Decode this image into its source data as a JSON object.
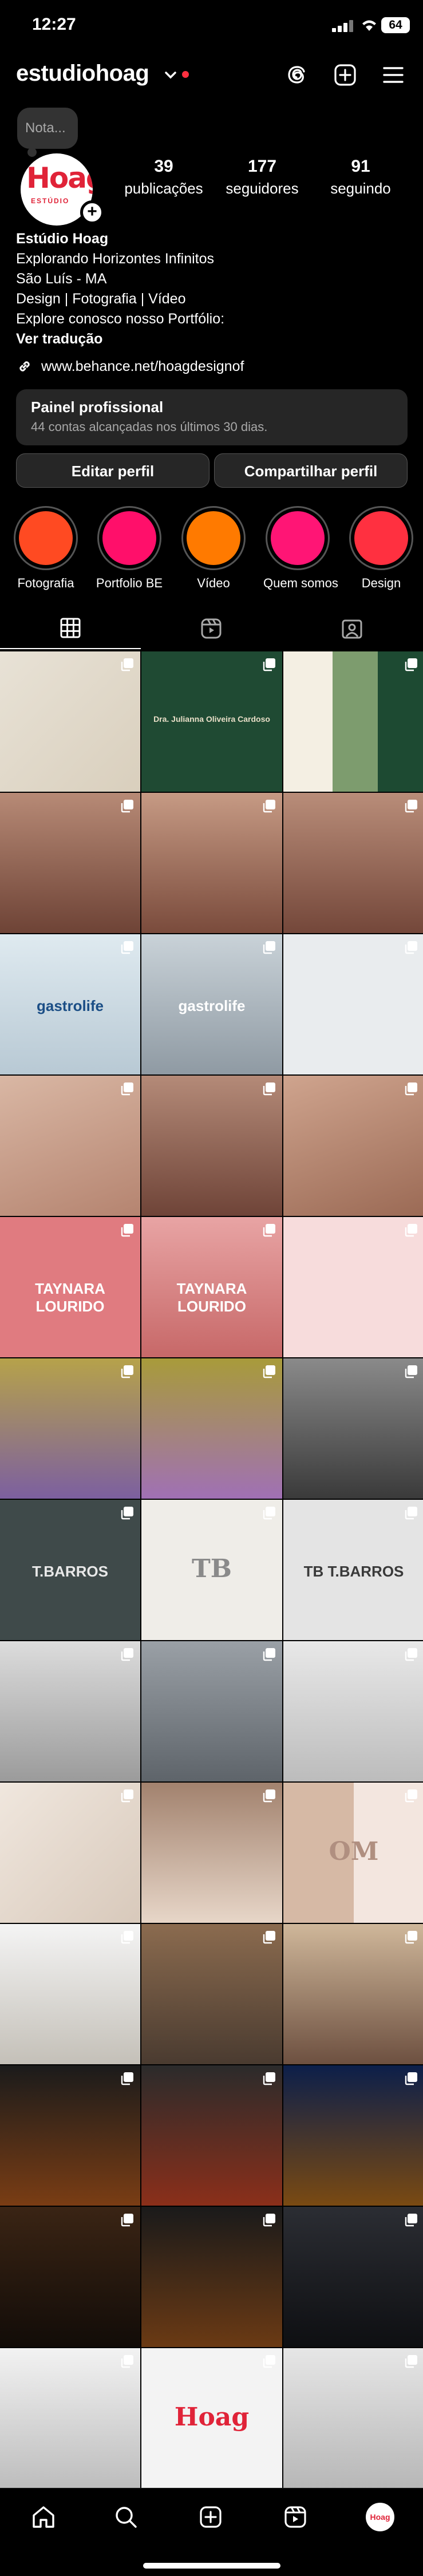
{
  "status": {
    "time": "12:27",
    "battery": "64"
  },
  "header": {
    "username": "estudiohoag"
  },
  "note": {
    "placeholder": "Nota..."
  },
  "avatar": {
    "logo_text": "Hoag",
    "logo_sub": "ESTÚDIO"
  },
  "stats": [
    {
      "value": "39",
      "label": "publicações"
    },
    {
      "value": "177",
      "label": "seguidores"
    },
    {
      "value": "91",
      "label": "seguindo"
    }
  ],
  "bio": {
    "name": "Estúdio Hoag",
    "lines": [
      "Explorando Horizontes Infinitos",
      "São Luís - MA",
      "Design | Fotografia | Vídeo",
      "Explore conosco nosso Portfólio:"
    ],
    "more": "Ver tradução",
    "link": "www.behance.net/hoagdesignof"
  },
  "panel": {
    "title": "Painel profissional",
    "subtitle": "44 contas alcançadas nos últimos 30 dias."
  },
  "buttons": {
    "edit": "Editar perfil",
    "share": "Compartilhar perfil"
  },
  "highlights": [
    {
      "label": "Fotografia",
      "color": "#ff4a22"
    },
    {
      "label": "Portfolio BE",
      "color": "#ff0f6a"
    },
    {
      "label": "Vídeo",
      "color": "#ff7a00"
    },
    {
      "label": "Quem somos",
      "color": "#ff1575"
    },
    {
      "label": "Design",
      "color": "#ff3040"
    }
  ],
  "tabs": [
    {
      "icon": "grid-icon"
    },
    {
      "icon": "reels-icon"
    },
    {
      "icon": "tagged-icon"
    }
  ],
  "posts": [
    {
      "bg": "linear-gradient(135deg,#e8e2d6,#d9cfbd)",
      "text": "",
      "color": "#1f4b34",
      "multi": true
    },
    {
      "bg": "#1f4a33",
      "text": "Dra. Julianna Oliveira Cardoso",
      "color": "#e9dfc8",
      "multi": true
    },
    {
      "bg": "linear-gradient(90deg,#f4efe3 35%,#7d9c6e 35%,#7d9c6e 67%,#1d4a32 67%)",
      "text": "",
      "color": "#1d4a32",
      "multi": true
    },
    {
      "bg": "linear-gradient(180deg,#b78a76,#6e4336)",
      "text": "",
      "color": "#fff",
      "multi": true
    },
    {
      "bg": "linear-gradient(180deg,#c69a84,#7a4b3c)",
      "text": "",
      "color": "#fff",
      "multi": true
    },
    {
      "bg": "linear-gradient(180deg,#b98d79,#74473a)",
      "text": "",
      "color": "#fff",
      "multi": true
    },
    {
      "bg": "linear-gradient(180deg,#dfeaf0,#b8c9d4)",
      "text": "gastrolife",
      "color": "#1b4e86",
      "multi": true
    },
    {
      "bg": "linear-gradient(180deg,#c9d2d8,#8f9aa3)",
      "text": "gastrolife",
      "color": "#ffffff",
      "multi": true
    },
    {
      "bg": "#e9ecee",
      "text": "",
      "color": "#1b4e86",
      "multi": true
    },
    {
      "bg": "linear-gradient(160deg,#d9b7a4,#b58470)",
      "text": "",
      "color": "#fff",
      "multi": true
    },
    {
      "bg": "linear-gradient(180deg,#b48a78,#6f4438)",
      "text": "",
      "color": "#fff",
      "multi": true
    },
    {
      "bg": "linear-gradient(160deg,#cfa48e,#9b6a55)",
      "text": "",
      "color": "#fff",
      "multi": true
    },
    {
      "bg": "#e07b80",
      "text": "TAYNARA LOURIDO",
      "color": "#fff",
      "multi": true
    },
    {
      "bg": "linear-gradient(180deg,#e8a4a4,#c76868)",
      "text": "TAYNARA LOURIDO",
      "color": "#fff",
      "multi": true
    },
    {
      "bg": "#f7dcdc",
      "text": "",
      "color": "#e27680",
      "multi": true
    },
    {
      "bg": "linear-gradient(180deg,#b6a24a,#7c5fa0)",
      "text": "",
      "color": "#fff",
      "multi": true
    },
    {
      "bg": "linear-gradient(180deg,#a89b3a,#a070b5)",
      "text": "",
      "color": "#fff",
      "multi": true
    },
    {
      "bg": "linear-gradient(180deg,#8a8a8a,#3a3a3a)",
      "text": "",
      "color": "#fff",
      "multi": true
    },
    {
      "bg": "#3f4a4a",
      "text": "T.BARROS",
      "color": "#e8e8e8",
      "multi": true
    },
    {
      "bg": "#efede8",
      "text": "TB",
      "color": "#8a8a8a",
      "multi": true
    },
    {
      "bg": "#e4e4e4",
      "text": "TB T.BARROS",
      "color": "#3a3a3a",
      "multi": true
    },
    {
      "bg": "linear-gradient(180deg,#dcdcdc,#9b9b9b)",
      "text": "",
      "color": "#fff",
      "multi": true
    },
    {
      "bg": "linear-gradient(180deg,#9aa0a6,#5e646a)",
      "text": "",
      "color": "#fff",
      "multi": true
    },
    {
      "bg": "linear-gradient(180deg,#e8e8e8,#bcbcbc)",
      "text": "",
      "color": "#fff",
      "multi": true
    },
    {
      "bg": "linear-gradient(135deg,#f0e7de,#d8c9bb)",
      "text": "",
      "color": "#2a4d2e",
      "multi": true
    },
    {
      "bg": "linear-gradient(180deg,#a2826e,#e7d6c8)",
      "text": "",
      "color": "#fff",
      "multi": true
    },
    {
      "bg": "linear-gradient(90deg,#d6b9a5 50%,#f3e6df 50%)",
      "text": "OM",
      "color": "#b08f80",
      "multi": true
    },
    {
      "bg": "linear-gradient(180deg,#f4f4f4,#c4c0b8)",
      "text": "",
      "color": "#fff",
      "multi": true
    },
    {
      "bg": "linear-gradient(180deg,#8b6b4f,#4a3b30)",
      "text": "",
      "color": "#fff",
      "multi": true
    },
    {
      "bg": "linear-gradient(180deg,#cfb79a,#6d5040)",
      "text": "",
      "color": "#fff",
      "multi": true
    },
    {
      "bg": "linear-gradient(180deg,#1b1b1b,#7a3d14)",
      "text": "",
      "color": "#fff",
      "multi": true
    },
    {
      "bg": "linear-gradient(180deg,#2b2b2b,#8b2f1a)",
      "text": "",
      "color": "#fff",
      "multi": true
    },
    {
      "bg": "linear-gradient(180deg,#0c1f4a,#7a4a12)",
      "text": "",
      "color": "#fff",
      "multi": true
    },
    {
      "bg": "linear-gradient(180deg,#3a2414,#120c08)",
      "text": "",
      "color": "#fff",
      "multi": true
    },
    {
      "bg": "linear-gradient(180deg,#1a1a1a,#6b3a14)",
      "text": "",
      "color": "#fff",
      "multi": true
    },
    {
      "bg": "linear-gradient(180deg,#2b2d33,#0e0f12)",
      "text": "",
      "color": "#fff",
      "multi": true
    },
    {
      "bg": "linear-gradient(180deg,#f2f2f2,#bdbdbd)",
      "text": "",
      "color": "#fff",
      "multi": true
    },
    {
      "bg": "#f3f3f3",
      "text": "Hoag",
      "color": "#e02338",
      "multi": true
    },
    {
      "bg": "linear-gradient(180deg,#e6e6e6,#b7b7b7)",
      "text": "",
      "color": "#fff",
      "multi": true
    }
  ],
  "nav": [
    {
      "icon": "home-icon"
    },
    {
      "icon": "search-icon"
    },
    {
      "icon": "create-icon"
    },
    {
      "icon": "reels-icon"
    },
    {
      "icon": "profile-avatar"
    }
  ],
  "profile_mini": "Hoag"
}
